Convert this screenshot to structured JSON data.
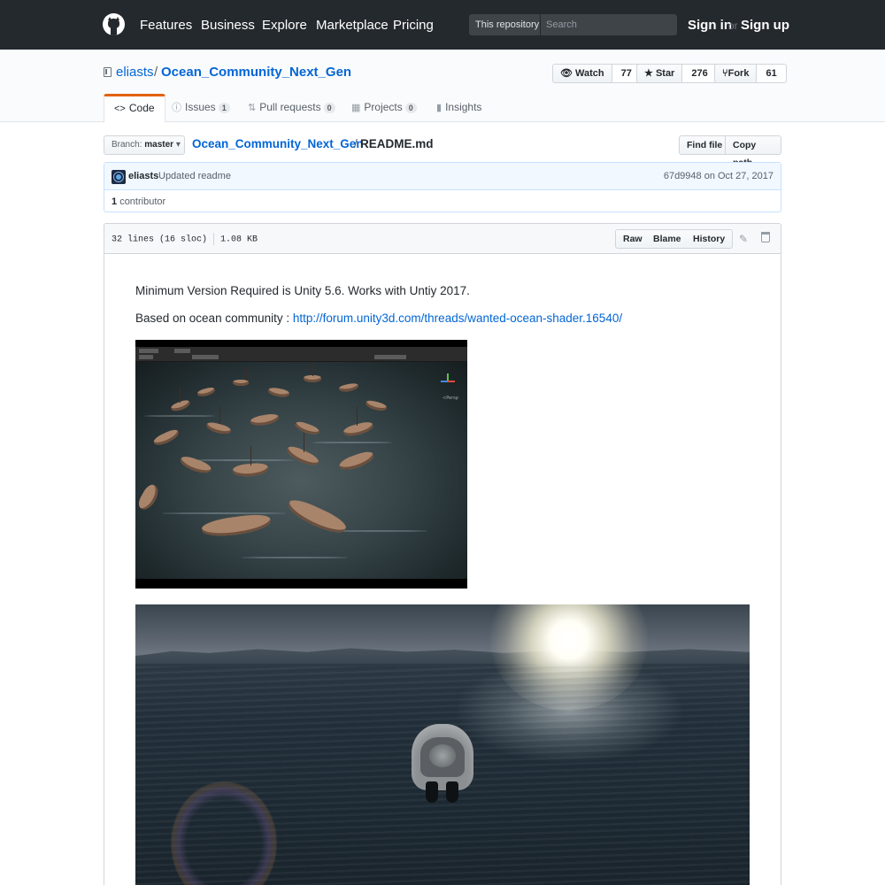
{
  "header": {
    "nav": [
      "Features",
      "Business",
      "Explore",
      "Marketplace",
      "Pricing"
    ],
    "scope_label": "This repository",
    "search_placeholder": "Search",
    "sign_in": "Sign in",
    "or": "or",
    "sign_up": "Sign up"
  },
  "repo": {
    "owner": "eliasts",
    "separator": "/",
    "name": "Ocean_Community_Next_Gen",
    "watch_label": "Watch",
    "watch_count": "77",
    "star_label": "Star",
    "star_count": "276",
    "fork_label": "Fork",
    "fork_count": "61"
  },
  "tabs": [
    {
      "label": "Code",
      "icon": "code-icon"
    },
    {
      "label": "Issues",
      "count": "1",
      "icon": "issue-icon"
    },
    {
      "label": "Pull requests",
      "count": "0",
      "icon": "pull-request-icon"
    },
    {
      "label": "Projects",
      "count": "0",
      "icon": "project-icon"
    },
    {
      "label": "Insights",
      "icon": "graph-icon"
    }
  ],
  "file_nav": {
    "branch_prefix": "Branch:",
    "branch": "master",
    "path_repo": "Ocean_Community_Next_Gen",
    "path_sep": "/",
    "path_file": "README.md",
    "find_file": "Find file",
    "copy_path": "Copy path"
  },
  "commit": {
    "author": "eliasts",
    "message": "Updated readme",
    "sha_date": "67d9948 on Oct 27, 2017",
    "contributors_count": "1",
    "contributors_label": "contributor"
  },
  "file": {
    "lines": "32 lines (16 sloc)",
    "size": "1.08 KB",
    "raw": "Raw",
    "blame": "Blame",
    "history": "History"
  },
  "readme": {
    "line1": "Minimum Version Required is Unity 5.6. Works with Untiy 2017.",
    "line2_prefix": "Based on ocean community : ",
    "line2_link": "http://forum.unity3d.com/threads/wanted-ocean-shader.16540/",
    "image1_persp_label": "<Persp"
  }
}
